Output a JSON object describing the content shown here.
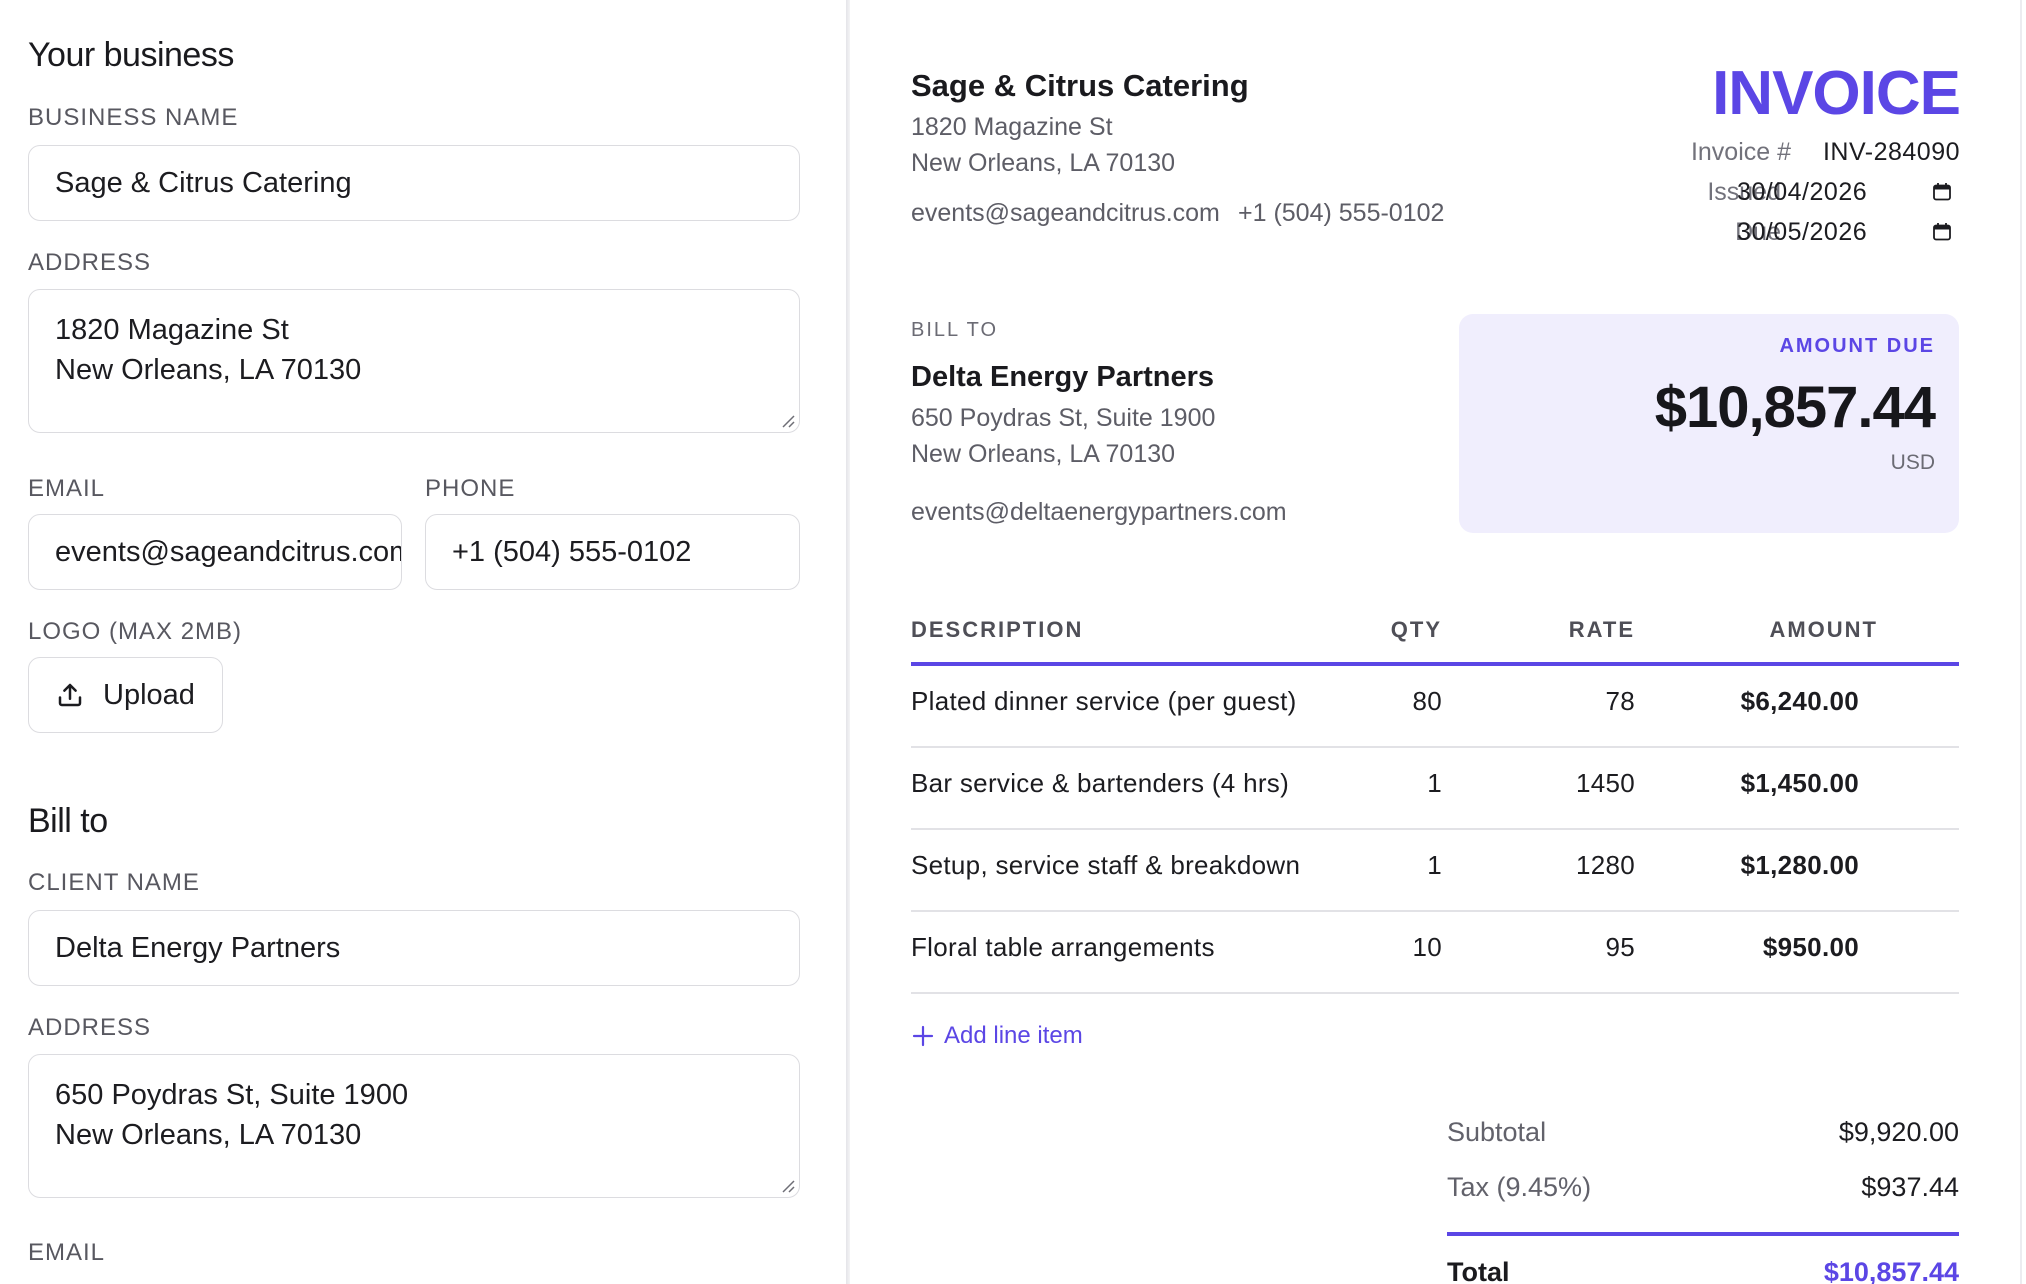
{
  "editor": {
    "your_business": {
      "title": "Your business",
      "business_name_label": "BUSINESS NAME",
      "business_name_value": "Sage & Citrus Catering",
      "address_label": "ADDRESS",
      "address_line1": "1820 Magazine St",
      "address_line2": "New Orleans, LA 70130",
      "email_label": "EMAIL",
      "email_value": "events@sageandcitrus.com",
      "phone_label": "PHONE",
      "phone_value": "+1 (504) 555-0102",
      "logo_label": "LOGO (MAX 2MB)",
      "upload_label": "Upload"
    },
    "bill_to": {
      "title": "Bill to",
      "client_name_label": "CLIENT NAME",
      "client_name_value": "Delta Energy Partners",
      "address_label": "ADDRESS",
      "address_line1": "650 Poydras St, Suite 1900",
      "address_line2": "New Orleans, LA 70130",
      "email_label": "EMAIL"
    }
  },
  "invoice": {
    "title": "INVOICE",
    "business": {
      "name": "Sage & Citrus Catering",
      "address_line1": "1820 Magazine St",
      "address_line2": "New Orleans, LA 70130",
      "email": "events@sageandcitrus.com",
      "phone": "+1 (504) 555-0102"
    },
    "meta": {
      "number_label": "Invoice #",
      "number_value": "INV-284090",
      "issued_label": "Issued",
      "issued_value": "30/04/2026",
      "due_label": "Due",
      "due_value": "30/05/2026"
    },
    "bill_to": {
      "label": "BILL TO",
      "name": "Delta Energy Partners",
      "address_line1": "650 Poydras St, Suite 1900",
      "address_line2": "New Orleans, LA 70130",
      "email": "events@deltaenergypartners.com"
    },
    "amount_due": {
      "label": "AMOUNT DUE",
      "value": "$10,857.44",
      "currency": "USD"
    },
    "table": {
      "headers": {
        "description": "DESCRIPTION",
        "qty": "QTY",
        "rate": "RATE",
        "amount": "AMOUNT"
      },
      "rows": [
        {
          "description": "Plated dinner service (per guest)",
          "qty": "80",
          "rate": "78",
          "amount": "$6,240.00"
        },
        {
          "description": "Bar service & bartenders (4 hrs)",
          "qty": "1",
          "rate": "1450",
          "amount": "$1,450.00"
        },
        {
          "description": "Setup, service staff & breakdown",
          "qty": "1",
          "rate": "1280",
          "amount": "$1,280.00"
        },
        {
          "description": "Floral table arrangements",
          "qty": "10",
          "rate": "95",
          "amount": "$950.00"
        }
      ],
      "add_line_label": "Add line item"
    },
    "totals": {
      "subtotal_label": "Subtotal",
      "subtotal_value": "$9,920.00",
      "tax_label": "Tax (9.45%)",
      "tax_value": "$937.44",
      "total_label": "Total",
      "total_value": "$10,857.44"
    }
  },
  "colors": {
    "accent": "#5b46e5",
    "amount_due_bg": "#f0eefd",
    "border": "#dcdce0"
  },
  "icons": {
    "upload": "upload-icon",
    "calendar": "calendar-icon",
    "plus": "plus-icon"
  }
}
